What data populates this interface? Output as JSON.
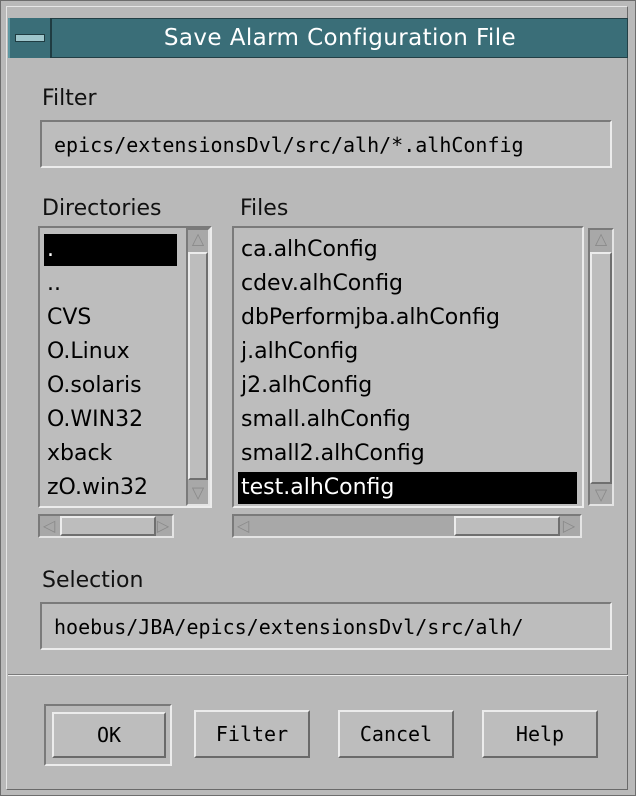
{
  "window": {
    "title": "Save Alarm Configuration File",
    "menu_icon": "window-menu-icon"
  },
  "filter": {
    "label": "Filter",
    "value": "epics/extensionsDvl/src/alh/*.alhConfig"
  },
  "directories": {
    "label": "Directories",
    "items": [
      ".",
      "..",
      "CVS",
      "O.Linux",
      "O.solaris",
      "O.WIN32",
      "xback",
      "zO.win32"
    ],
    "selected_index": 0
  },
  "files": {
    "label": "Files",
    "items": [
      "ca.alhConfig",
      "cdev.alhConfig",
      "dbPerformjba.alhConfig",
      "j.alhConfig",
      "j2.alhConfig",
      "small.alhConfig",
      "small2.alhConfig",
      "test.alhConfig"
    ],
    "selected_index": 7
  },
  "selection": {
    "label": "Selection",
    "value": "hoebus/JBA/epics/extensionsDvl/src/alh/"
  },
  "buttons": {
    "ok": "OK",
    "filter": "Filter",
    "cancel": "Cancel",
    "help": "Help"
  },
  "icons": {
    "up": "scroll-up-arrow-icon",
    "down": "scroll-down-arrow-icon",
    "left": "scroll-left-arrow-icon",
    "right": "scroll-right-arrow-icon"
  }
}
